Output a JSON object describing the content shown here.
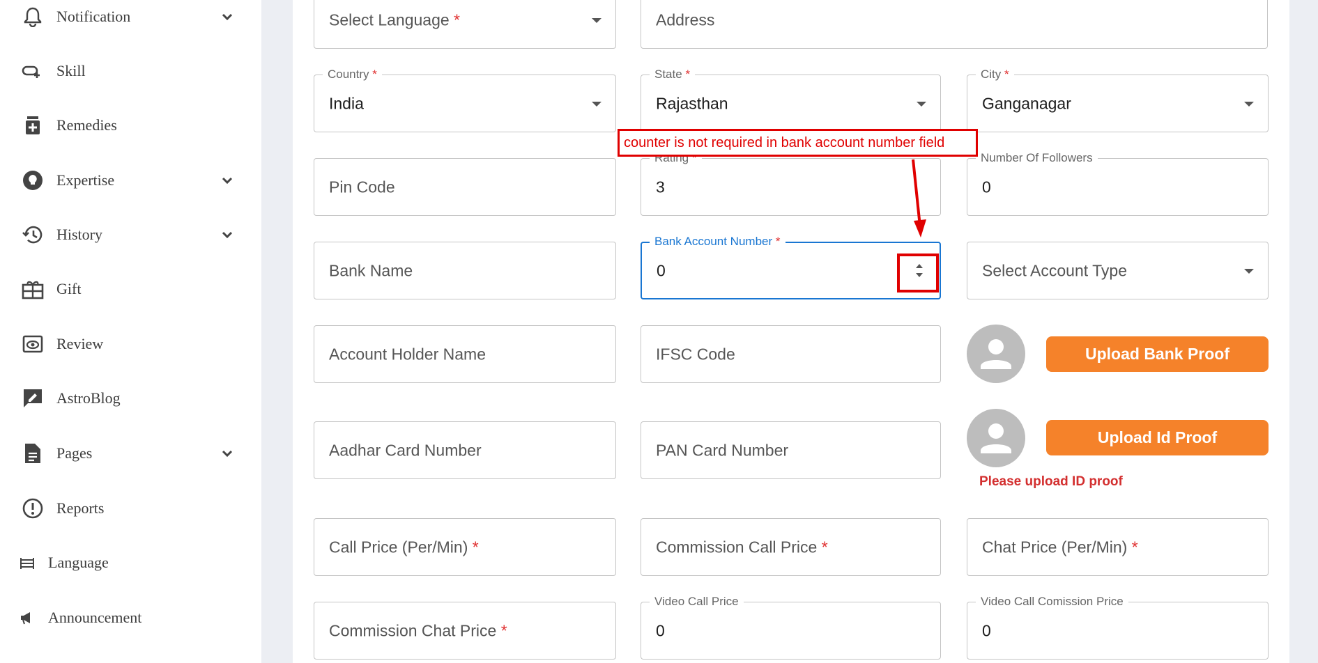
{
  "sidebar": {
    "items": [
      {
        "label": "Notification",
        "icon": "bell-icon",
        "has_submenu": true
      },
      {
        "label": "Skill",
        "icon": "link-plus-icon",
        "has_submenu": false
      },
      {
        "label": "Remedies",
        "icon": "medicine-icon",
        "has_submenu": false
      },
      {
        "label": "Expertise",
        "icon": "lightbulb-icon",
        "has_submenu": true
      },
      {
        "label": "History",
        "icon": "history-icon",
        "has_submenu": true
      },
      {
        "label": "Gift",
        "icon": "gift-icon",
        "has_submenu": false
      },
      {
        "label": "Review",
        "icon": "review-eye-icon",
        "has_submenu": false
      },
      {
        "label": "AstroBlog",
        "icon": "edit-blog-icon",
        "has_submenu": false
      },
      {
        "label": "Pages",
        "icon": "document-icon",
        "has_submenu": true
      },
      {
        "label": "Reports",
        "icon": "report-alert-icon",
        "has_submenu": false
      },
      {
        "label": "Language",
        "icon": "language-icon",
        "has_submenu": false
      },
      {
        "label": "Announcement",
        "icon": "megaphone-icon",
        "has_submenu": false
      }
    ]
  },
  "form": {
    "select_language": {
      "placeholder": "Select Language",
      "required_mark": "*"
    },
    "address": {
      "placeholder": "Address"
    },
    "country": {
      "label": "Country",
      "required_mark": "*",
      "value": "India"
    },
    "state": {
      "label": "State",
      "required_mark": "*",
      "value": "Rajasthan"
    },
    "city": {
      "label": "City",
      "required_mark": "*",
      "value": "Ganganagar"
    },
    "pin_code": {
      "placeholder": "Pin Code"
    },
    "rating": {
      "label": "Rating",
      "required_mark": "*",
      "value": "3"
    },
    "followers": {
      "label": "Number Of Followers",
      "value": "0"
    },
    "bank_name": {
      "placeholder": "Bank Name"
    },
    "bank_account": {
      "label": "Bank Account Number",
      "required_mark": "*",
      "value": "0"
    },
    "account_type": {
      "placeholder": "Select Account Type"
    },
    "account_holder": {
      "placeholder": "Account Holder Name"
    },
    "ifsc": {
      "placeholder": "IFSC Code"
    },
    "upload_bank_proof": "Upload Bank Proof",
    "aadhar": {
      "placeholder": "Aadhar Card Number"
    },
    "pan": {
      "placeholder": "PAN Card Number"
    },
    "upload_id_proof": "Upload Id Proof",
    "id_proof_error": "Please upload ID proof",
    "call_price": {
      "placeholder": "Call Price (Per/Min)",
      "required_mark": "*"
    },
    "commission_call_price": {
      "placeholder": "Commission Call Price",
      "required_mark": "*"
    },
    "chat_price": {
      "placeholder": "Chat Price (Per/Min)",
      "required_mark": "*"
    },
    "commission_chat_price": {
      "placeholder": "Commission Chat Price",
      "required_mark": "*"
    },
    "video_call_price": {
      "label": "Video Call Price",
      "value": "0"
    },
    "video_call_commission": {
      "label": "Video Call Comission Price",
      "value": "0"
    }
  },
  "annotation": {
    "text": "counter is not required in bank account number  field"
  },
  "colors": {
    "accent": "#1976d2",
    "upload_button": "#f5822a",
    "error": "#d32f2f",
    "annotation": "#e00000",
    "top_bar": "#1f5a5a"
  }
}
